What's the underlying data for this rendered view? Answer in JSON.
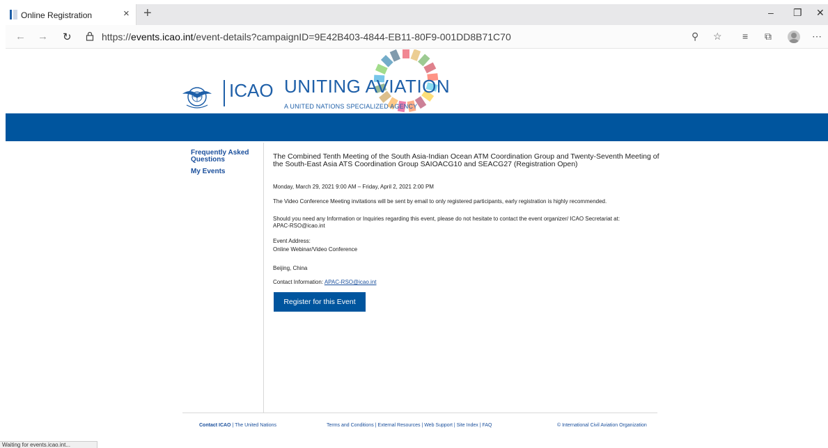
{
  "browser": {
    "tab_title": "Online Registration",
    "tab_close": "×",
    "new_tab": "+",
    "url_prefix": "https://",
    "url_host": "events.icao.int",
    "url_path": "/event-details?campaignID=9E42B403-4844-EB11-80F9-001DD8B71C70",
    "icons": [
      "back-icon",
      "forward-icon",
      "reload-icon",
      "lock-icon",
      "zoom-icon",
      "favorite-star-icon",
      "favorites-list-icon",
      "collections-icon",
      "profile-avatar",
      "more-menu-icon"
    ],
    "window_controls": {
      "minimize": "–",
      "restore": "❐",
      "close": "✕"
    }
  },
  "header": {
    "icao": "ICAO",
    "uniting": "UNITING AVIATION",
    "agency": "A UNITED NATIONS SPECIALIZED AGENCY",
    "brand_color": "#00559e"
  },
  "sidebar": {
    "faq": "Frequently Asked Questions",
    "my_events": "My Events"
  },
  "event": {
    "title": "The Combined Tenth Meeting of the South Asia-Indian Ocean ATM Coordination Group and Twenty-Seventh Meeting of the South-East Asia ATS Coordination Group SAIOACG10 and SEACG27 (Registration Open)",
    "dates": "Monday, March 29, 2021 9:00 AM – Friday, April 2, 2021 2:00 PM",
    "invitation_note": "The Video Conference Meeting invitations will be sent by email to only registered participants, early registration is highly recommended.",
    "inquiries_note": "Should you need any Information or Inquiries regarding this event, please do not hesitate to contact the event organizer/ ICAO Secretariat at:",
    "inquiries_email": "APAC-RSO@icao.int",
    "address_label": "Event Address:",
    "address_line1": "Online Webinar/Video Conference",
    "address_city": "Beijing, China",
    "contact_label": "Contact Information:",
    "contact_email": "APAC-RSO@icao.int",
    "register_button": "Register for this Event"
  },
  "footer": {
    "left": "Contact ICAO",
    "left_sep": " | The United Nations",
    "middle": "Terms and Conditions | External Resources | Web Support | Site Index | FAQ",
    "right": "© International Civil Aviation Organization"
  },
  "status_bar": "Waiting for events.icao.int..."
}
